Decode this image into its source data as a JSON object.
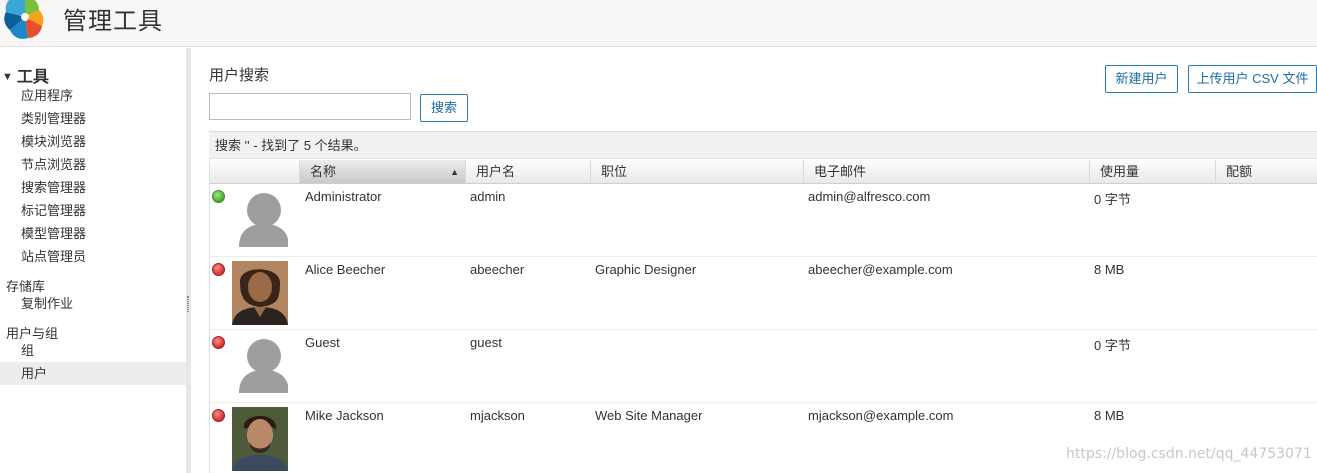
{
  "header": {
    "title": "管理工具"
  },
  "sidebar": {
    "group_title": "工具",
    "tools": [
      "应用程序",
      "类别管理器",
      "模块浏览器",
      "节点浏览器",
      "搜索管理器",
      "标记管理器",
      "模型管理器",
      "站点管理员"
    ],
    "repo_label": "存储库",
    "repo_items": [
      "复制作业"
    ],
    "users_label": "用户与组",
    "users_items": [
      "组",
      "用户"
    ]
  },
  "main": {
    "title": "用户搜索",
    "search": {
      "value": "",
      "button": "搜索"
    },
    "actions": {
      "new_user": "新建用户",
      "upload_csv": "上传用户 CSV 文件"
    },
    "result_text": "搜索 '' - 找到了 5 个结果。"
  },
  "table": {
    "columns": [
      "名称",
      "用户名",
      "职位",
      "电子邮件",
      "使用量",
      "配额"
    ],
    "sorted_column": "名称",
    "rows": [
      {
        "status": "online",
        "avatar": "default-avatar",
        "name": "Administrator",
        "username": "admin",
        "job": "",
        "email": "admin@alfresco.com",
        "usage": "0 字节"
      },
      {
        "status": "offline",
        "avatar": "photo-avatar",
        "name": "Alice Beecher",
        "username": "abeecher",
        "job": "Graphic Designer",
        "email": "abeecher@example.com",
        "usage": "8 MB"
      },
      {
        "status": "offline",
        "avatar": "default-avatar",
        "name": "Guest",
        "username": "guest",
        "job": "",
        "email": "",
        "usage": "0 字节"
      },
      {
        "status": "offline",
        "avatar": "photo-avatar",
        "name": "Mike Jackson",
        "username": "mjackson",
        "job": "Web Site Manager",
        "email": "mjackson@example.com",
        "usage": "8 MB"
      }
    ]
  },
  "colors": {
    "accent": "#1c6ea8",
    "online": "#45a82b",
    "offline": "#d12c2c"
  },
  "watermark": "https://blog.csdn.net/qq_44753071"
}
